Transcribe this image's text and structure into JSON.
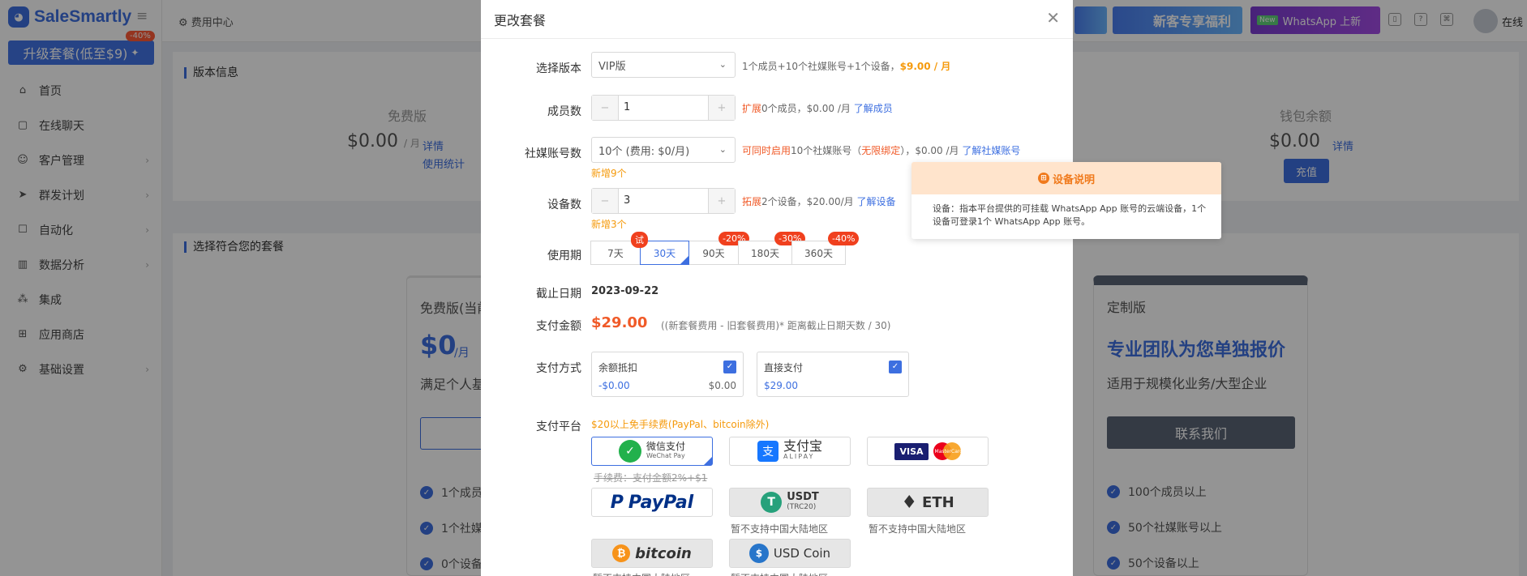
{
  "app": {
    "name": "SaleSmartly"
  },
  "sidebar": {
    "upgrade_label": "升级套餐(低至$9)",
    "upgrade_badge": "-40%",
    "items": [
      {
        "label": "首页",
        "icon": "home-icon"
      },
      {
        "label": "在线聊天",
        "icon": "chat-icon"
      },
      {
        "label": "客户管理",
        "icon": "users-icon"
      },
      {
        "label": "群发计划",
        "icon": "send-icon"
      },
      {
        "label": "自动化",
        "icon": "robot-icon"
      },
      {
        "label": "数据分析",
        "icon": "chart-icon"
      },
      {
        "label": "集成",
        "icon": "integration-icon"
      },
      {
        "label": "应用商店",
        "icon": "apps-icon"
      },
      {
        "label": "基础设置",
        "icon": "gear-icon"
      }
    ]
  },
  "topbar": {
    "breadcrumb": "费用中心",
    "promo_new_customer": "新客专享福利",
    "promo_whatsapp_new": "New",
    "promo_whatsapp": "WhatsApp 上新",
    "status": "在线"
  },
  "background": {
    "version_title": "版本信息",
    "free_label": "免费版",
    "free_value": "$0.00",
    "per_month": "/ 月",
    "details": "详情",
    "usage": "使用统计",
    "wallet_label": "钱包余额",
    "wallet_value": "$0.00",
    "recharge": "充值",
    "choose_title": "选择符合您的套餐",
    "free_card_title": "免费版(当前",
    "free_card_price": "$0",
    "free_card_per": "/月",
    "free_card_desc": "满足个人基",
    "free_features": [
      "1个成员",
      "1个社媒",
      "0个设备"
    ],
    "custom_title": "定制版",
    "custom_headline": "专业团队为您单独报价",
    "custom_desc": "适用于规模化业务/大型企业",
    "custom_button": "联系我们",
    "custom_features": [
      "100个成员以上",
      "50个社媒账号以上",
      "50个设备以上"
    ]
  },
  "modal": {
    "title": "更改套餐",
    "version_label": "选择版本",
    "version_value": "VIP版",
    "version_hint": "1个成员+10个社媒账号+1个设备，",
    "version_price": "$9.00 / 月",
    "members_label": "成员数",
    "members_value": "1",
    "members_hint_prefix": "扩展",
    "members_hint": "0个成员，$0.00 /月",
    "members_link": "了解成员",
    "social_label": "社媒账号数",
    "social_value": "10个 (费用: $0/月)",
    "social_hint_prefix": "可同时启用",
    "social_hint_mid": "10个社媒账号（",
    "social_hint_unlimited": "无限绑定",
    "social_hint_end": "），$0.00 /月",
    "social_link": "了解社媒账号",
    "social_added": "新增9个",
    "devices_label": "设备数",
    "devices_value": "3",
    "devices_hint_prefix": "拓展",
    "devices_hint": "2个设备，$20.00/月",
    "devices_link": "了解设备",
    "devices_added": "新增3个",
    "period_label": "使用期",
    "periods": [
      {
        "label": "7天",
        "badge": ""
      },
      {
        "label": "30天",
        "badge": "试"
      },
      {
        "label": "90天",
        "badge": "-20%"
      },
      {
        "label": "180天",
        "badge": "-30%"
      },
      {
        "label": "360天",
        "badge": "-40%"
      }
    ],
    "deadline_label": "截止日期",
    "deadline_value": "2023-09-22",
    "amount_label": "支付金额",
    "amount_value": "$29.00",
    "amount_formula": "((新套餐费用 - 旧套餐费用)* 距离截止日期天数 / 30)",
    "method_label": "支付方式",
    "balance_title": "余额抵扣",
    "balance_deduct": "-$0.00",
    "balance_total": "$0.00",
    "direct_title": "直接支付",
    "direct_value": "$29.00",
    "platform_label": "支付平台",
    "platform_note": "$20以上免手续费(PayPal、bitcoin除外)",
    "fee_note": "手续费：支付金额2%+$1",
    "platforms": {
      "wechat": "微信支付",
      "wechat_sub": "WeChat Pay",
      "alipay": "支付宝",
      "alipay_sub": "ALIPAY",
      "visa": "VISA",
      "mastercard": "MasterCard",
      "paypal": "PayPal",
      "usdt": "USDT",
      "usdt_sub": "(TRC20)",
      "eth": "ETH",
      "bitcoin": "bitcoin",
      "usdc": "USD Coin"
    },
    "unsupported": "暂不支持中国大陆地区"
  },
  "tooltip": {
    "title": "设备说明",
    "body": "设备：指本平台提供的可挂载 WhatsApp App 账号的云端设备，1个设备可登录1个 WhatsApp App 账号。"
  },
  "colors": {
    "accent": "#3d6fe0",
    "orange": "#f59a0c",
    "red": "#f05a28"
  }
}
